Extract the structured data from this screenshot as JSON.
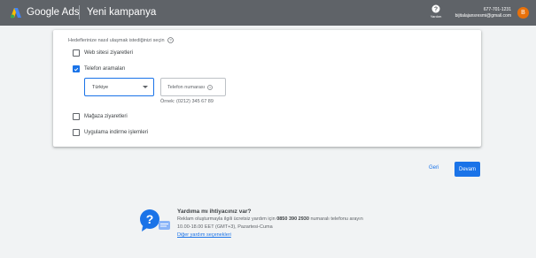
{
  "header": {
    "brand": "Google Ads",
    "campaign_title": "Yeni kampanya",
    "help_label": "Yardım",
    "account_phone": "677-701-1231",
    "account_email": "bijitalajansresmi@gmail.com",
    "avatar_letter": "B"
  },
  "form": {
    "question": "Hedeflerinize nasıl ulaşmak istediğinizi seçin",
    "options": [
      {
        "label": "Web sitesi ziyaretleri",
        "checked": false
      },
      {
        "label": "Telefon aramaları",
        "checked": true
      },
      {
        "label": "Mağaza ziyaretleri",
        "checked": false
      },
      {
        "label": "Uygulama indirme işlemleri",
        "checked": false
      }
    ],
    "country_select": {
      "value": "Türkiye"
    },
    "phone_input": {
      "placeholder": "Telefon numarası"
    },
    "phone_hint": "Örnek: (0212) 345 67 89"
  },
  "actions": {
    "back_label": "Geri",
    "next_label": "Devam"
  },
  "help": {
    "title": "Yardıma mı ihtiyacınız var?",
    "line1_prefix": "Reklam oluşturmayla ilgili ücretsiz yardım için",
    "phone": "0850 390 2930",
    "line1_suffix": "numaralı telefonu arayın",
    "line2": "10.00-18.00 EET (GMT+3), Pazartesi-Cuma",
    "link": "Diğer yardım seçenekleri"
  },
  "colors": {
    "header_bg": "#5f6368",
    "accent": "#1a73e8",
    "avatar": "#e8710a"
  }
}
